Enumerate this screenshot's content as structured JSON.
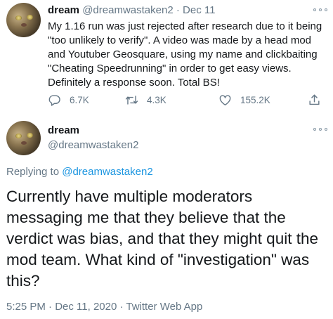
{
  "tweet1": {
    "display_name": "dream",
    "handle": "@dreamwastaken2",
    "separator": "·",
    "date": "Dec 11",
    "text": "My 1.16 run was just rejected after research due to it being \"too unlikely to verify\". A video was made by a head mod and Youtuber Geosquare, using my name and clickbaiting \"Cheating Speedrunning\" in order to get easy views. Definitely a response soon. Total BS!",
    "reply_count": "6.7K",
    "retweet_count": "4.3K",
    "like_count": "155.2K"
  },
  "tweet2": {
    "display_name": "dream",
    "handle": "@dreamwastaken2",
    "replying_prefix": "Replying to",
    "replying_handle": "@dreamwastaken2",
    "text": "Currently have multiple moderators messaging me that they believe that the verdict was bias, and that they might quit the mod team. What kind of \"investigation\" was this?",
    "timestamp": "5:25 PM · Dec 11, 2020 · Twitter Web App"
  },
  "icons": {
    "reply": "reply-icon",
    "retweet": "retweet-icon",
    "like": "heart-icon",
    "share": "share-icon",
    "more": "more-options-icon"
  },
  "colors": {
    "text": "#14171a",
    "muted": "#657786",
    "link": "#1b95e0"
  }
}
